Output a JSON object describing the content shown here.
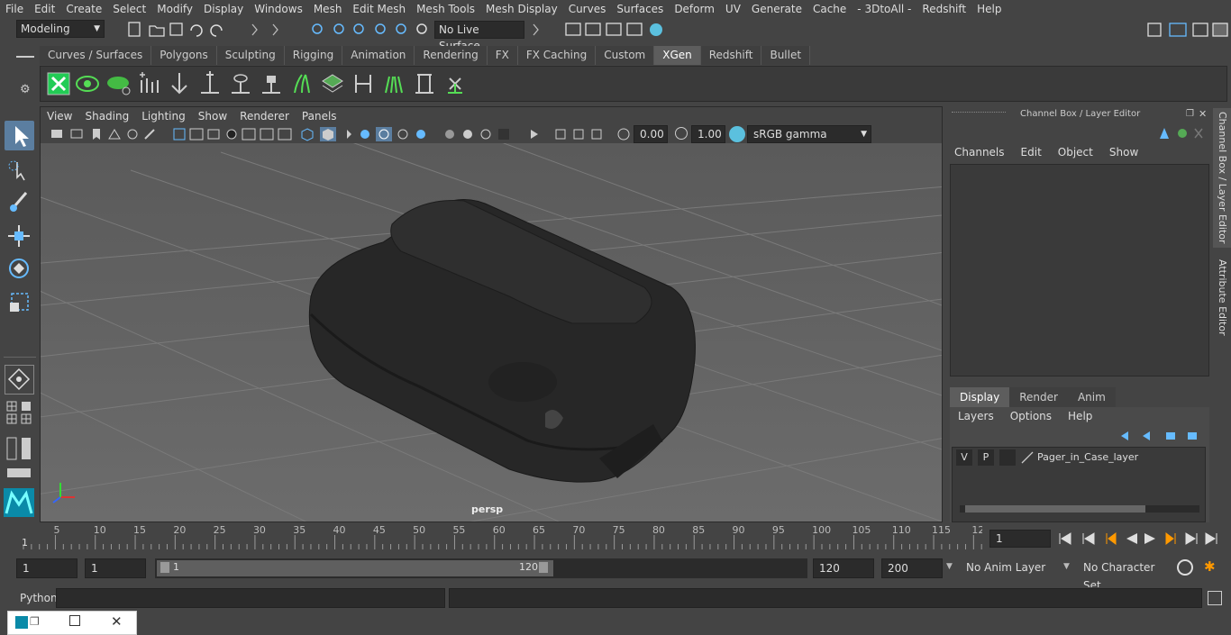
{
  "menubar": {
    "items": [
      "File",
      "Edit",
      "Create",
      "Select",
      "Modify",
      "Display",
      "Windows",
      "Mesh",
      "Edit Mesh",
      "Mesh Tools",
      "Mesh Display",
      "Curves",
      "Surfaces",
      "Deform",
      "UV",
      "Generate",
      "Cache",
      "- 3DtoAll -",
      "Redshift",
      "Help"
    ]
  },
  "statusline": {
    "mode": "Modeling",
    "live_surface": "No Live Surface"
  },
  "shelf": {
    "tabs": [
      "Curves / Surfaces",
      "Polygons",
      "Sculpting",
      "Rigging",
      "Animation",
      "Rendering",
      "FX",
      "FX Caching",
      "Custom",
      "XGen",
      "Redshift",
      "Bullet"
    ],
    "active_tab": "XGen"
  },
  "viewport": {
    "menu": [
      "View",
      "Shading",
      "Lighting",
      "Show",
      "Renderer",
      "Panels"
    ],
    "exposure": "0.00",
    "gamma": "1.00",
    "color_space": "sRGB gamma",
    "camera_label": "persp"
  },
  "channelbox": {
    "title": "Channel Box / Layer Editor",
    "menu": [
      "Channels",
      "Edit",
      "Object",
      "Show"
    ],
    "layer_tabs": [
      "Display",
      "Render",
      "Anim"
    ],
    "active_layer_tab": "Display",
    "layer_menu": [
      "Layers",
      "Options",
      "Help"
    ],
    "layer": {
      "v": "V",
      "p": "P",
      "name": "Pager_in_Case_layer"
    },
    "side_tabs": [
      "Channel Box / Layer Editor",
      "Attribute Editor"
    ]
  },
  "timeline": {
    "ticks": [
      "5",
      "10",
      "15",
      "20",
      "25",
      "30",
      "35",
      "40",
      "45",
      "50",
      "55",
      "60",
      "65",
      "70",
      "75",
      "80",
      "85",
      "90",
      "95",
      "100",
      "105",
      "110",
      "115",
      "12"
    ],
    "start_label": "1",
    "current_frame": "1"
  },
  "range": {
    "start": "1",
    "playback_start": "1",
    "slider_start": "1",
    "slider_end": "120",
    "playback_end": "120",
    "end": "200",
    "anim_layer": "No Anim Layer",
    "character_set": "No Character Set"
  },
  "cmdline": {
    "label": "Python"
  }
}
